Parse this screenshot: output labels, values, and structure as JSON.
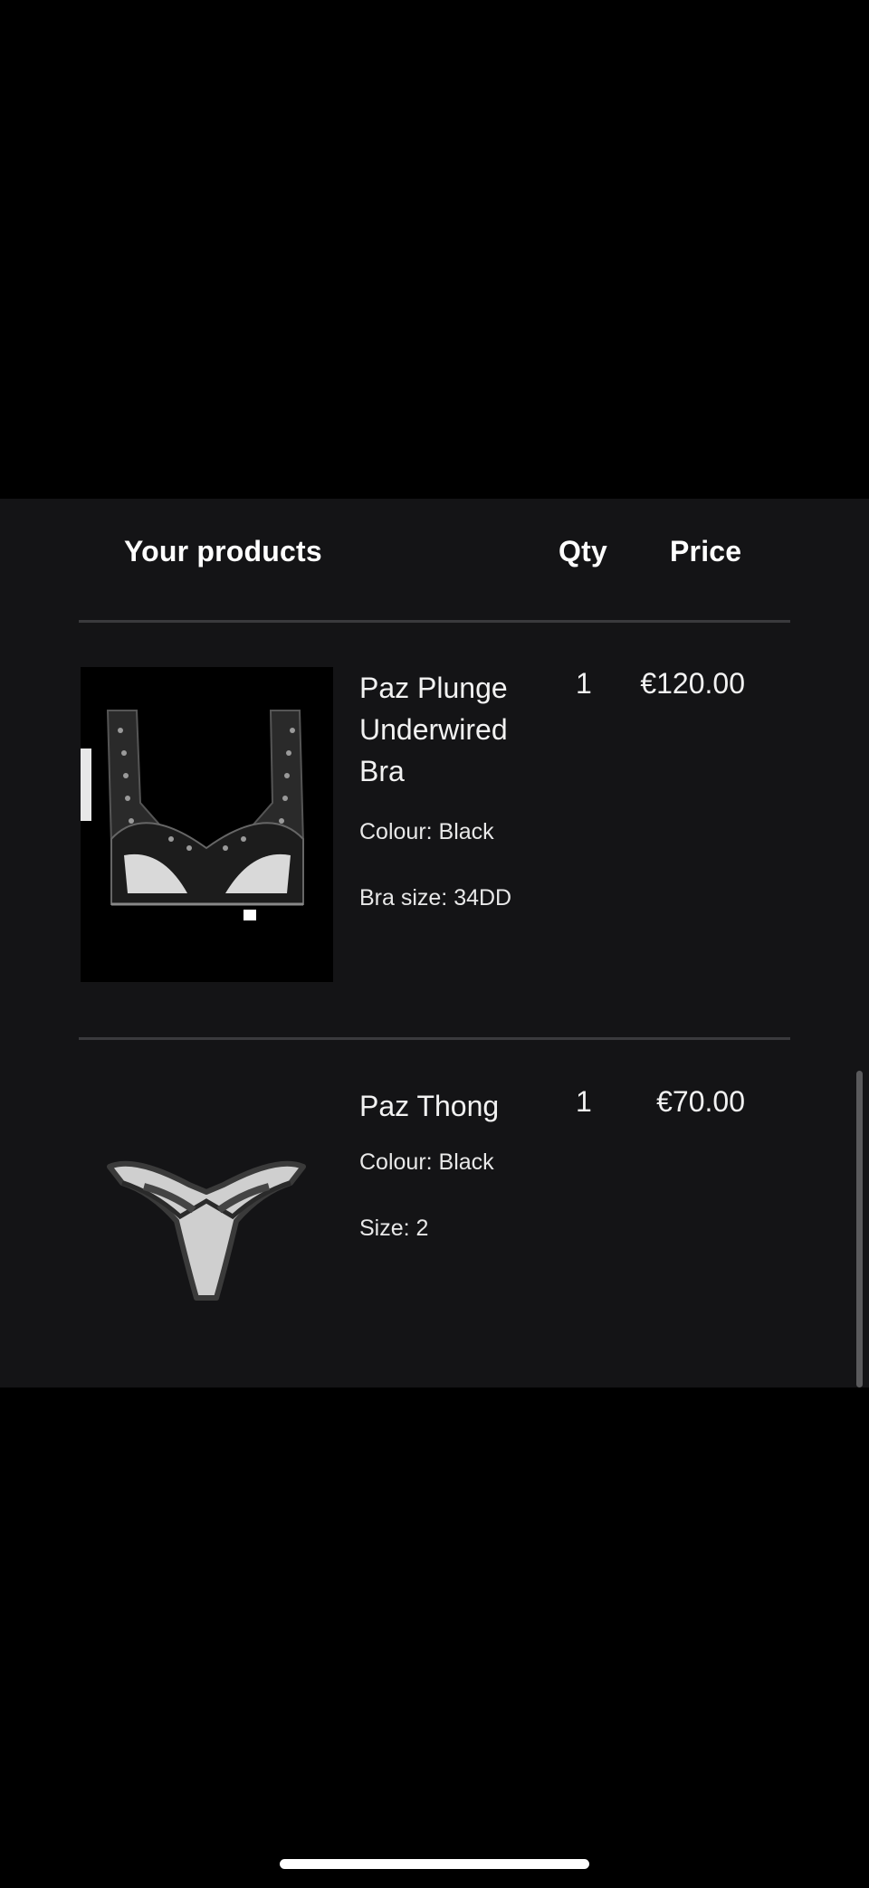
{
  "cart": {
    "header": {
      "products_label": "Your products",
      "qty_label": "Qty",
      "price_label": "Price"
    },
    "items": [
      {
        "name": "Paz Plunge Underwired Bra",
        "colour": "Colour: Black",
        "size": "Bra size: 34DD",
        "qty": "1",
        "price": "€120.00",
        "image_icon": "bra-product-image"
      },
      {
        "name": "Paz Thong",
        "colour": "Colour: Black",
        "size": "Size: 2",
        "qty": "1",
        "price": "€70.00",
        "image_icon": "thong-product-image"
      }
    ]
  },
  "colors": {
    "background": "#000000",
    "panel": "#141416",
    "divider": "#3a3a3d",
    "text": "#ffffff"
  }
}
